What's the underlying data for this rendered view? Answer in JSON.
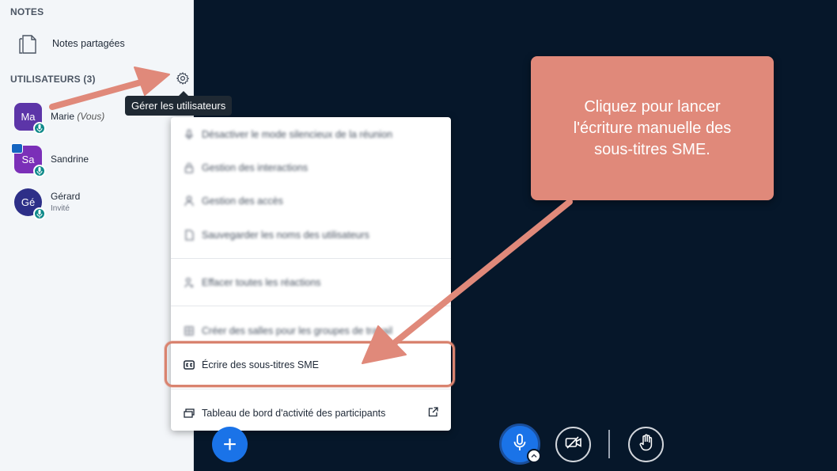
{
  "sidebar": {
    "notes_title": "NOTES",
    "shared_notes_label": "Notes partagées",
    "users_title": "UTILISATEURS (3)",
    "users": [
      {
        "initials": "Ma",
        "name": "Marie",
        "suffix": "(Vous)",
        "role": "",
        "color": "#5c35a8",
        "shape": "square"
      },
      {
        "initials": "Sa",
        "name": "Sandrine",
        "suffix": "",
        "role": "",
        "color": "#7b2fb8",
        "shape": "square",
        "presenter": true
      },
      {
        "initials": "Gé",
        "name": "Gérard",
        "suffix": "",
        "role": "Invité",
        "color": "#2d2f88",
        "shape": "round"
      }
    ]
  },
  "tooltip": {
    "text": "Gérer les utilisateurs"
  },
  "menu": {
    "items": [
      {
        "label": "Désactiver le mode silencieux de la réunion",
        "icon": "mic-icon",
        "blurred": true
      },
      {
        "label": "Gestion des interactions",
        "icon": "lock-icon",
        "blurred": true
      },
      {
        "label": "Gestion des accès",
        "icon": "user-icon",
        "blurred": true
      },
      {
        "label": "Sauvegarder les noms des utilisateurs",
        "icon": "file-icon",
        "blurred": true
      },
      {
        "label": "Effacer toutes les réactions",
        "icon": "user-clear-icon",
        "blurred": true
      },
      {
        "label": "Créer des salles pour les groupes de travail",
        "icon": "rooms-icon",
        "blurred": true
      },
      {
        "label": "Écrire des sous-titres SME",
        "icon": "closed-captions-icon",
        "blurred": false
      },
      {
        "label": "Tableau de bord d'activité des participants",
        "icon": "dashboard-icon",
        "blurred": false,
        "external": true
      }
    ]
  },
  "callout": {
    "text": "Cliquez pour lancer l'écriture manuelle des sous-titres SME."
  },
  "controls": {
    "plus": "+",
    "icons": [
      "plus-icon",
      "microphone-icon",
      "camera-off-icon",
      "raise-hand-icon"
    ]
  },
  "colors": {
    "background": "#06172a",
    "accent": "#1a73e8",
    "callout": "#e0897a",
    "mic_badge": "#0f8a8a"
  }
}
